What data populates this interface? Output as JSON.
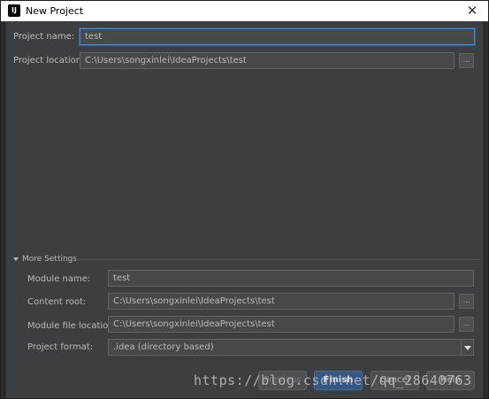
{
  "window": {
    "title": "New Project",
    "app_icon": "IJ",
    "close_glyph": "✕"
  },
  "form": {
    "project_name_label": "Project name:",
    "project_name_value": "test",
    "project_location_label": "Project location:",
    "project_location_value": "C:\\Users\\songxinlei\\IdeaProjects\\test",
    "browse_glyph": "..."
  },
  "more_settings": {
    "header": "More Settings",
    "module_name_label": "Module name:",
    "module_name_value": "test",
    "content_root_label": "Content root:",
    "content_root_value": "C:\\Users\\songxinlei\\IdeaProjects\\test",
    "module_file_location_label": "Module file location:",
    "module_file_location_value": "C:\\Users\\songxinlei\\IdeaProjects\\test",
    "project_format_label": "Project format:",
    "project_format_value": ".idea (directory based)"
  },
  "buttons": {
    "previous": "Previous",
    "finish": "Finish",
    "cancel": "Cancel",
    "help": "Help"
  },
  "watermark": "https://blog.csdn.net/qq_28640763",
  "colors": {
    "background": "#3c3f41",
    "field_background": "#45494a",
    "accent": "#4a88c7",
    "primary_button": "#365880"
  }
}
